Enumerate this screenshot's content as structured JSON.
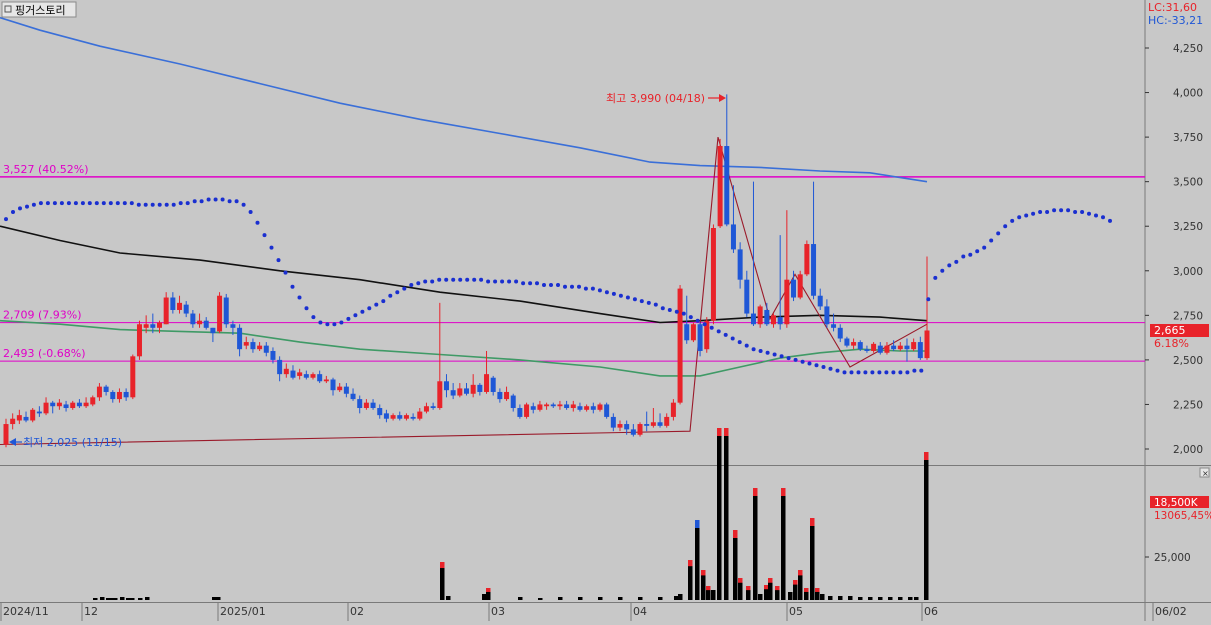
{
  "title": "핑거스토리",
  "colors": {
    "background": "#c8c8c8",
    "up": "#e8232a",
    "down": "#1f57d6",
    "ma_long": "#3a6fd8",
    "ma_mid": "#111111",
    "ma_short": "#3f9a66",
    "parabolic": "#1a2fd0",
    "hline": "#e000c8",
    "volume": "#000000"
  },
  "header": {
    "lc_label": "LC:31,60",
    "hc_label": "HC:-33,21"
  },
  "annotations": {
    "high_label": "최고 3,990 (04/18)",
    "low_label": "최저 2,025 (11/15)"
  },
  "price_axis": {
    "ticks": [
      "4,250",
      "4,000",
      "3,750",
      "3,500",
      "3,250",
      "3,000",
      "2,750",
      "2,500",
      "2,250",
      "2,000"
    ],
    "current_price": "2,665",
    "current_change": "6.18%"
  },
  "volume_axis": {
    "tick": "25,000",
    "current_volume": "18,500K",
    "avg_label": "13065,45%"
  },
  "time_axis": {
    "labels": [
      "2024/11",
      "12",
      "2025/01",
      "02",
      "03",
      "04",
      "05",
      "06",
      "06/02"
    ]
  },
  "chart_data": {
    "type": "candlestick",
    "title": "핑거스토리",
    "ylim": [
      1960,
      4420
    ],
    "horizontal_lines": [
      {
        "value": 3527,
        "label": "3,527 (40.52%)"
      },
      {
        "value": 2709,
        "label": "2,709 (7.93%)"
      },
      {
        "value": 2493,
        "label": "2,493 (-0.68%)"
      }
    ],
    "high": {
      "value": 3990,
      "date": "04/18"
    },
    "low": {
      "value": 2025,
      "date": "11/15"
    },
    "candles": [
      [
        2025,
        2140,
        2010,
        2170
      ],
      [
        2140,
        2170,
        2110,
        2200
      ],
      [
        2160,
        2190,
        2140,
        2220
      ],
      [
        2180,
        2160,
        2150,
        2210
      ],
      [
        2160,
        2220,
        2150,
        2230
      ],
      [
        2210,
        2200,
        2180,
        2240
      ],
      [
        2200,
        2260,
        2190,
        2290
      ],
      [
        2260,
        2240,
        2200,
        2270
      ],
      [
        2240,
        2260,
        2220,
        2280
      ],
      [
        2250,
        2230,
        2210,
        2270
      ],
      [
        2230,
        2260,
        2220,
        2270
      ],
      [
        2260,
        2240,
        2230,
        2280
      ],
      [
        2240,
        2260,
        2230,
        2290
      ],
      [
        2250,
        2290,
        2240,
        2300
      ],
      [
        2290,
        2350,
        2270,
        2370
      ],
      [
        2350,
        2320,
        2300,
        2360
      ],
      [
        2320,
        2280,
        2260,
        2330
      ],
      [
        2280,
        2320,
        2260,
        2340
      ],
      [
        2320,
        2290,
        2270,
        2340
      ],
      [
        2290,
        2520,
        2280,
        2530
      ],
      [
        2520,
        2700,
        2500,
        2720
      ],
      [
        2680,
        2700,
        2650,
        2750
      ],
      [
        2700,
        2680,
        2650,
        2760
      ],
      [
        2680,
        2710,
        2650,
        2720
      ],
      [
        2700,
        2850,
        2700,
        2880
      ],
      [
        2850,
        2780,
        2760,
        2880
      ],
      [
        2780,
        2820,
        2760,
        2860
      ],
      [
        2810,
        2760,
        2740,
        2830
      ],
      [
        2760,
        2700,
        2680,
        2780
      ],
      [
        2700,
        2720,
        2680,
        2760
      ],
      [
        2720,
        2680,
        2670,
        2740
      ],
      [
        2680,
        2650,
        2600,
        2680
      ],
      [
        2660,
        2860,
        2650,
        2880
      ],
      [
        2850,
        2700,
        2680,
        2870
      ],
      [
        2700,
        2680,
        2640,
        2720
      ],
      [
        2680,
        2560,
        2520,
        2700
      ],
      [
        2580,
        2600,
        2560,
        2630
      ],
      [
        2600,
        2560,
        2540,
        2620
      ],
      [
        2560,
        2580,
        2550,
        2600
      ],
      [
        2580,
        2540,
        2520,
        2600
      ],
      [
        2550,
        2500,
        2480,
        2570
      ],
      [
        2500,
        2420,
        2380,
        2520
      ],
      [
        2420,
        2450,
        2400,
        2480
      ],
      [
        2440,
        2400,
        2390,
        2470
      ],
      [
        2410,
        2430,
        2390,
        2450
      ],
      [
        2420,
        2400,
        2390,
        2440
      ],
      [
        2400,
        2420,
        2390,
        2430
      ],
      [
        2420,
        2380,
        2370,
        2440
      ],
      [
        2380,
        2390,
        2370,
        2410
      ],
      [
        2390,
        2330,
        2300,
        2400
      ],
      [
        2330,
        2350,
        2320,
        2370
      ],
      [
        2350,
        2310,
        2290,
        2370
      ],
      [
        2310,
        2280,
        2270,
        2340
      ],
      [
        2280,
        2230,
        2200,
        2300
      ],
      [
        2230,
        2260,
        2220,
        2280
      ],
      [
        2260,
        2230,
        2220,
        2280
      ],
      [
        2230,
        2190,
        2170,
        2250
      ],
      [
        2200,
        2170,
        2150,
        2220
      ],
      [
        2170,
        2190,
        2160,
        2200
      ],
      [
        2190,
        2170,
        2160,
        2210
      ],
      [
        2170,
        2190,
        2160,
        2200
      ],
      [
        2180,
        2170,
        2160,
        2200
      ],
      [
        2170,
        2210,
        2160,
        2230
      ],
      [
        2210,
        2240,
        2200,
        2260
      ],
      [
        2240,
        2230,
        2220,
        2260
      ],
      [
        2230,
        2380,
        2220,
        2820
      ],
      [
        2380,
        2330,
        2290,
        2420
      ],
      [
        2330,
        2300,
        2280,
        2370
      ],
      [
        2300,
        2340,
        2290,
        2370
      ],
      [
        2340,
        2310,
        2300,
        2370
      ],
      [
        2310,
        2360,
        2290,
        2420
      ],
      [
        2360,
        2320,
        2300,
        2370
      ],
      [
        2320,
        2420,
        2310,
        2550
      ],
      [
        2400,
        2320,
        2300,
        2410
      ],
      [
        2320,
        2280,
        2260,
        2340
      ],
      [
        2280,
        2320,
        2270,
        2350
      ],
      [
        2300,
        2230,
        2210,
        2310
      ],
      [
        2230,
        2180,
        2170,
        2250
      ],
      [
        2180,
        2250,
        2170,
        2260
      ],
      [
        2240,
        2220,
        2200,
        2260
      ],
      [
        2220,
        2250,
        2210,
        2270
      ],
      [
        2240,
        2250,
        2220,
        2260
      ],
      [
        2250,
        2240,
        2230,
        2260
      ],
      [
        2240,
        2250,
        2220,
        2270
      ],
      [
        2250,
        2230,
        2220,
        2270
      ],
      [
        2230,
        2250,
        2210,
        2270
      ],
      [
        2240,
        2220,
        2210,
        2260
      ],
      [
        2220,
        2240,
        2210,
        2250
      ],
      [
        2240,
        2220,
        2200,
        2260
      ],
      [
        2220,
        2250,
        2210,
        2260
      ],
      [
        2250,
        2180,
        2170,
        2260
      ],
      [
        2180,
        2120,
        2100,
        2200
      ],
      [
        2120,
        2140,
        2100,
        2160
      ],
      [
        2140,
        2110,
        2080,
        2160
      ],
      [
        2110,
        2080,
        2070,
        2140
      ],
      [
        2080,
        2140,
        2070,
        2150
      ],
      [
        2140,
        2130,
        2100,
        2210
      ],
      [
        2130,
        2150,
        2120,
        2230
      ],
      [
        2150,
        2130,
        2120,
        2200
      ],
      [
        2130,
        2180,
        2120,
        2200
      ],
      [
        2180,
        2260,
        2160,
        2280
      ],
      [
        2260,
        2900,
        2250,
        2920
      ],
      [
        2700,
        2610,
        2590,
        2860
      ],
      [
        2610,
        2700,
        2600,
        2710
      ],
      [
        2700,
        2550,
        2520,
        2710
      ],
      [
        2560,
        2720,
        2540,
        2740
      ],
      [
        2720,
        3240,
        2700,
        3260
      ],
      [
        3250,
        3700,
        3240,
        3740
      ],
      [
        3700,
        3260,
        3250,
        3990
      ],
      [
        3260,
        3120,
        3100,
        3480
      ],
      [
        3120,
        2950,
        2900,
        3160
      ],
      [
        2950,
        2760,
        2740,
        3000
      ],
      [
        2760,
        2700,
        2690,
        3500
      ],
      [
        2700,
        2800,
        2680,
        2810
      ],
      [
        2780,
        2700,
        2690,
        2820
      ],
      [
        2700,
        2750,
        2680,
        2760
      ],
      [
        2740,
        2700,
        2670,
        3200
      ],
      [
        2700,
        2950,
        2680,
        3340
      ],
      [
        2950,
        2850,
        2830,
        3000
      ],
      [
        2850,
        2980,
        2840,
        3000
      ],
      [
        2980,
        3150,
        2970,
        3170
      ],
      [
        3150,
        2860,
        2840,
        3500
      ],
      [
        2860,
        2800,
        2780,
        2900
      ],
      [
        2800,
        2700,
        2680,
        2840
      ],
      [
        2700,
        2680,
        2660,
        2760
      ],
      [
        2680,
        2620,
        2600,
        2700
      ],
      [
        2620,
        2580,
        2570,
        2630
      ],
      [
        2580,
        2600,
        2560,
        2620
      ],
      [
        2600,
        2560,
        2550,
        2610
      ],
      [
        2560,
        2550,
        2540,
        2580
      ],
      [
        2550,
        2590,
        2540,
        2600
      ],
      [
        2580,
        2540,
        2530,
        2600
      ],
      [
        2540,
        2580,
        2530,
        2600
      ],
      [
        2580,
        2560,
        2550,
        2610
      ],
      [
        2560,
        2580,
        2550,
        2600
      ],
      [
        2580,
        2560,
        2490,
        2620
      ],
      [
        2560,
        2600,
        2550,
        2620
      ],
      [
        2600,
        2510,
        2500,
        2630
      ],
      [
        2510,
        2665,
        2500,
        3080
      ]
    ],
    "parabolic_sar": [
      3290,
      3330,
      3350,
      3360,
      3370,
      3380,
      3380,
      3380,
      3380,
      3380,
      3380,
      3380,
      3380,
      3380,
      3380,
      3380,
      3380,
      3380,
      3380,
      3370,
      3370,
      3370,
      3370,
      3370,
      3370,
      3380,
      3380,
      3390,
      3390,
      3400,
      3400,
      3400,
      3390,
      3390,
      3370,
      3330,
      3270,
      3200,
      3130,
      3060,
      2990,
      2910,
      2850,
      2790,
      2740,
      2710,
      2700,
      2700,
      2710,
      2730,
      2750,
      2770,
      2790,
      2810,
      2830,
      2860,
      2880,
      2900,
      2920,
      2930,
      2940,
      2940,
      2950,
      2950,
      2950,
      2950,
      2950,
      2950,
      2950,
      2940,
      2940,
      2940,
      2940,
      2940,
      2930,
      2930,
      2930,
      2920,
      2920,
      2920,
      2910,
      2910,
      2910,
      2900,
      2900,
      2890,
      2880,
      2870,
      2860,
      2850,
      2840,
      2830,
      2820,
      2810,
      2790,
      2780,
      2770,
      2760,
      2740,
      2720,
      2700,
      2680,
      2660,
      2640,
      2620,
      2600,
      2580,
      2560,
      2550,
      2540,
      2530,
      2520,
      2510,
      2500,
      2490,
      2480,
      2470,
      2460,
      2450,
      2440,
      2430,
      2430,
      2430,
      2430,
      2430,
      2430,
      2430,
      2430,
      2430,
      2430,
      2440,
      2440,
      2840,
      2960,
      3000,
      3030,
      3050,
      3080,
      3090,
      3110,
      3130,
      3170,
      3210,
      3250,
      3280,
      3300,
      3310,
      3320,
      3330,
      3330,
      3340,
      3340,
      3340,
      3330,
      3330,
      3320,
      3310,
      3300,
      3280
    ],
    "ma_long": [
      [
        0,
        4420
      ],
      [
        40,
        4350
      ],
      [
        100,
        4260
      ],
      [
        180,
        4160
      ],
      [
        260,
        4050
      ],
      [
        340,
        3940
      ],
      [
        420,
        3850
      ],
      [
        500,
        3770
      ],
      [
        580,
        3690
      ],
      [
        650,
        3610
      ],
      [
        700,
        3590
      ],
      [
        760,
        3580
      ],
      [
        820,
        3560
      ],
      [
        870,
        3550
      ],
      [
        927,
        3500
      ]
    ],
    "ma_mid": [
      [
        0,
        3250
      ],
      [
        60,
        3170
      ],
      [
        120,
        3100
      ],
      [
        200,
        3060
      ],
      [
        280,
        3000
      ],
      [
        360,
        2950
      ],
      [
        440,
        2880
      ],
      [
        520,
        2830
      ],
      [
        600,
        2760
      ],
      [
        660,
        2710
      ],
      [
        700,
        2720
      ],
      [
        760,
        2740
      ],
      [
        820,
        2750
      ],
      [
        880,
        2740
      ],
      [
        927,
        2720
      ]
    ],
    "ma_short": [
      [
        0,
        2720
      ],
      [
        60,
        2700
      ],
      [
        120,
        2670
      ],
      [
        180,
        2660
      ],
      [
        240,
        2650
      ],
      [
        300,
        2600
      ],
      [
        360,
        2560
      ],
      [
        440,
        2530
      ],
      [
        520,
        2500
      ],
      [
        600,
        2460
      ],
      [
        660,
        2410
      ],
      [
        700,
        2410
      ],
      [
        740,
        2460
      ],
      [
        780,
        2510
      ],
      [
        820,
        2540
      ],
      [
        860,
        2560
      ],
      [
        900,
        2550
      ],
      [
        927,
        2550
      ]
    ],
    "zigzag": [
      [
        0,
        2025
      ],
      [
        690,
        2100
      ],
      [
        718,
        3750
      ],
      [
        770,
        2730
      ],
      [
        795,
        2980
      ],
      [
        850,
        2460
      ],
      [
        927,
        2700
      ]
    ],
    "volume": {
      "tick_value": 25000,
      "bars": [
        [
          95,
          2
        ],
        [
          102,
          3
        ],
        [
          108,
          2
        ],
        [
          112,
          2
        ],
        [
          115,
          2
        ],
        [
          122,
          3
        ],
        [
          128,
          2
        ],
        [
          132,
          2
        ],
        [
          140,
          2
        ],
        [
          147,
          3
        ],
        [
          214,
          3
        ],
        [
          218,
          3
        ],
        [
          442,
          38
        ],
        [
          448,
          4
        ],
        [
          484,
          6
        ],
        [
          488,
          12
        ],
        [
          520,
          3
        ],
        [
          540,
          2
        ],
        [
          560,
          3
        ],
        [
          580,
          3
        ],
        [
          600,
          3
        ],
        [
          620,
          3
        ],
        [
          640,
          3
        ],
        [
          660,
          3
        ],
        [
          676,
          4
        ],
        [
          680,
          6
        ],
        [
          690,
          40
        ],
        [
          697,
          80
        ],
        [
          703,
          30
        ],
        [
          708,
          14
        ],
        [
          713,
          10
        ],
        [
          719,
          172
        ],
        [
          726,
          172
        ],
        [
          735,
          70
        ],
        [
          740,
          22
        ],
        [
          748,
          14
        ],
        [
          755,
          112
        ],
        [
          760,
          6
        ],
        [
          766,
          15
        ],
        [
          770,
          22
        ],
        [
          777,
          14
        ],
        [
          783,
          112
        ],
        [
          790,
          8
        ],
        [
          795,
          20
        ],
        [
          800,
          30
        ],
        [
          806,
          12
        ],
        [
          812,
          82
        ],
        [
          817,
          12
        ],
        [
          822,
          6
        ],
        [
          830,
          4
        ],
        [
          840,
          4
        ],
        [
          850,
          4
        ],
        [
          860,
          3
        ],
        [
          870,
          3
        ],
        [
          880,
          3
        ],
        [
          890,
          3
        ],
        [
          900,
          3
        ],
        [
          910,
          3
        ],
        [
          916,
          3
        ],
        [
          926,
          148
        ]
      ]
    }
  }
}
